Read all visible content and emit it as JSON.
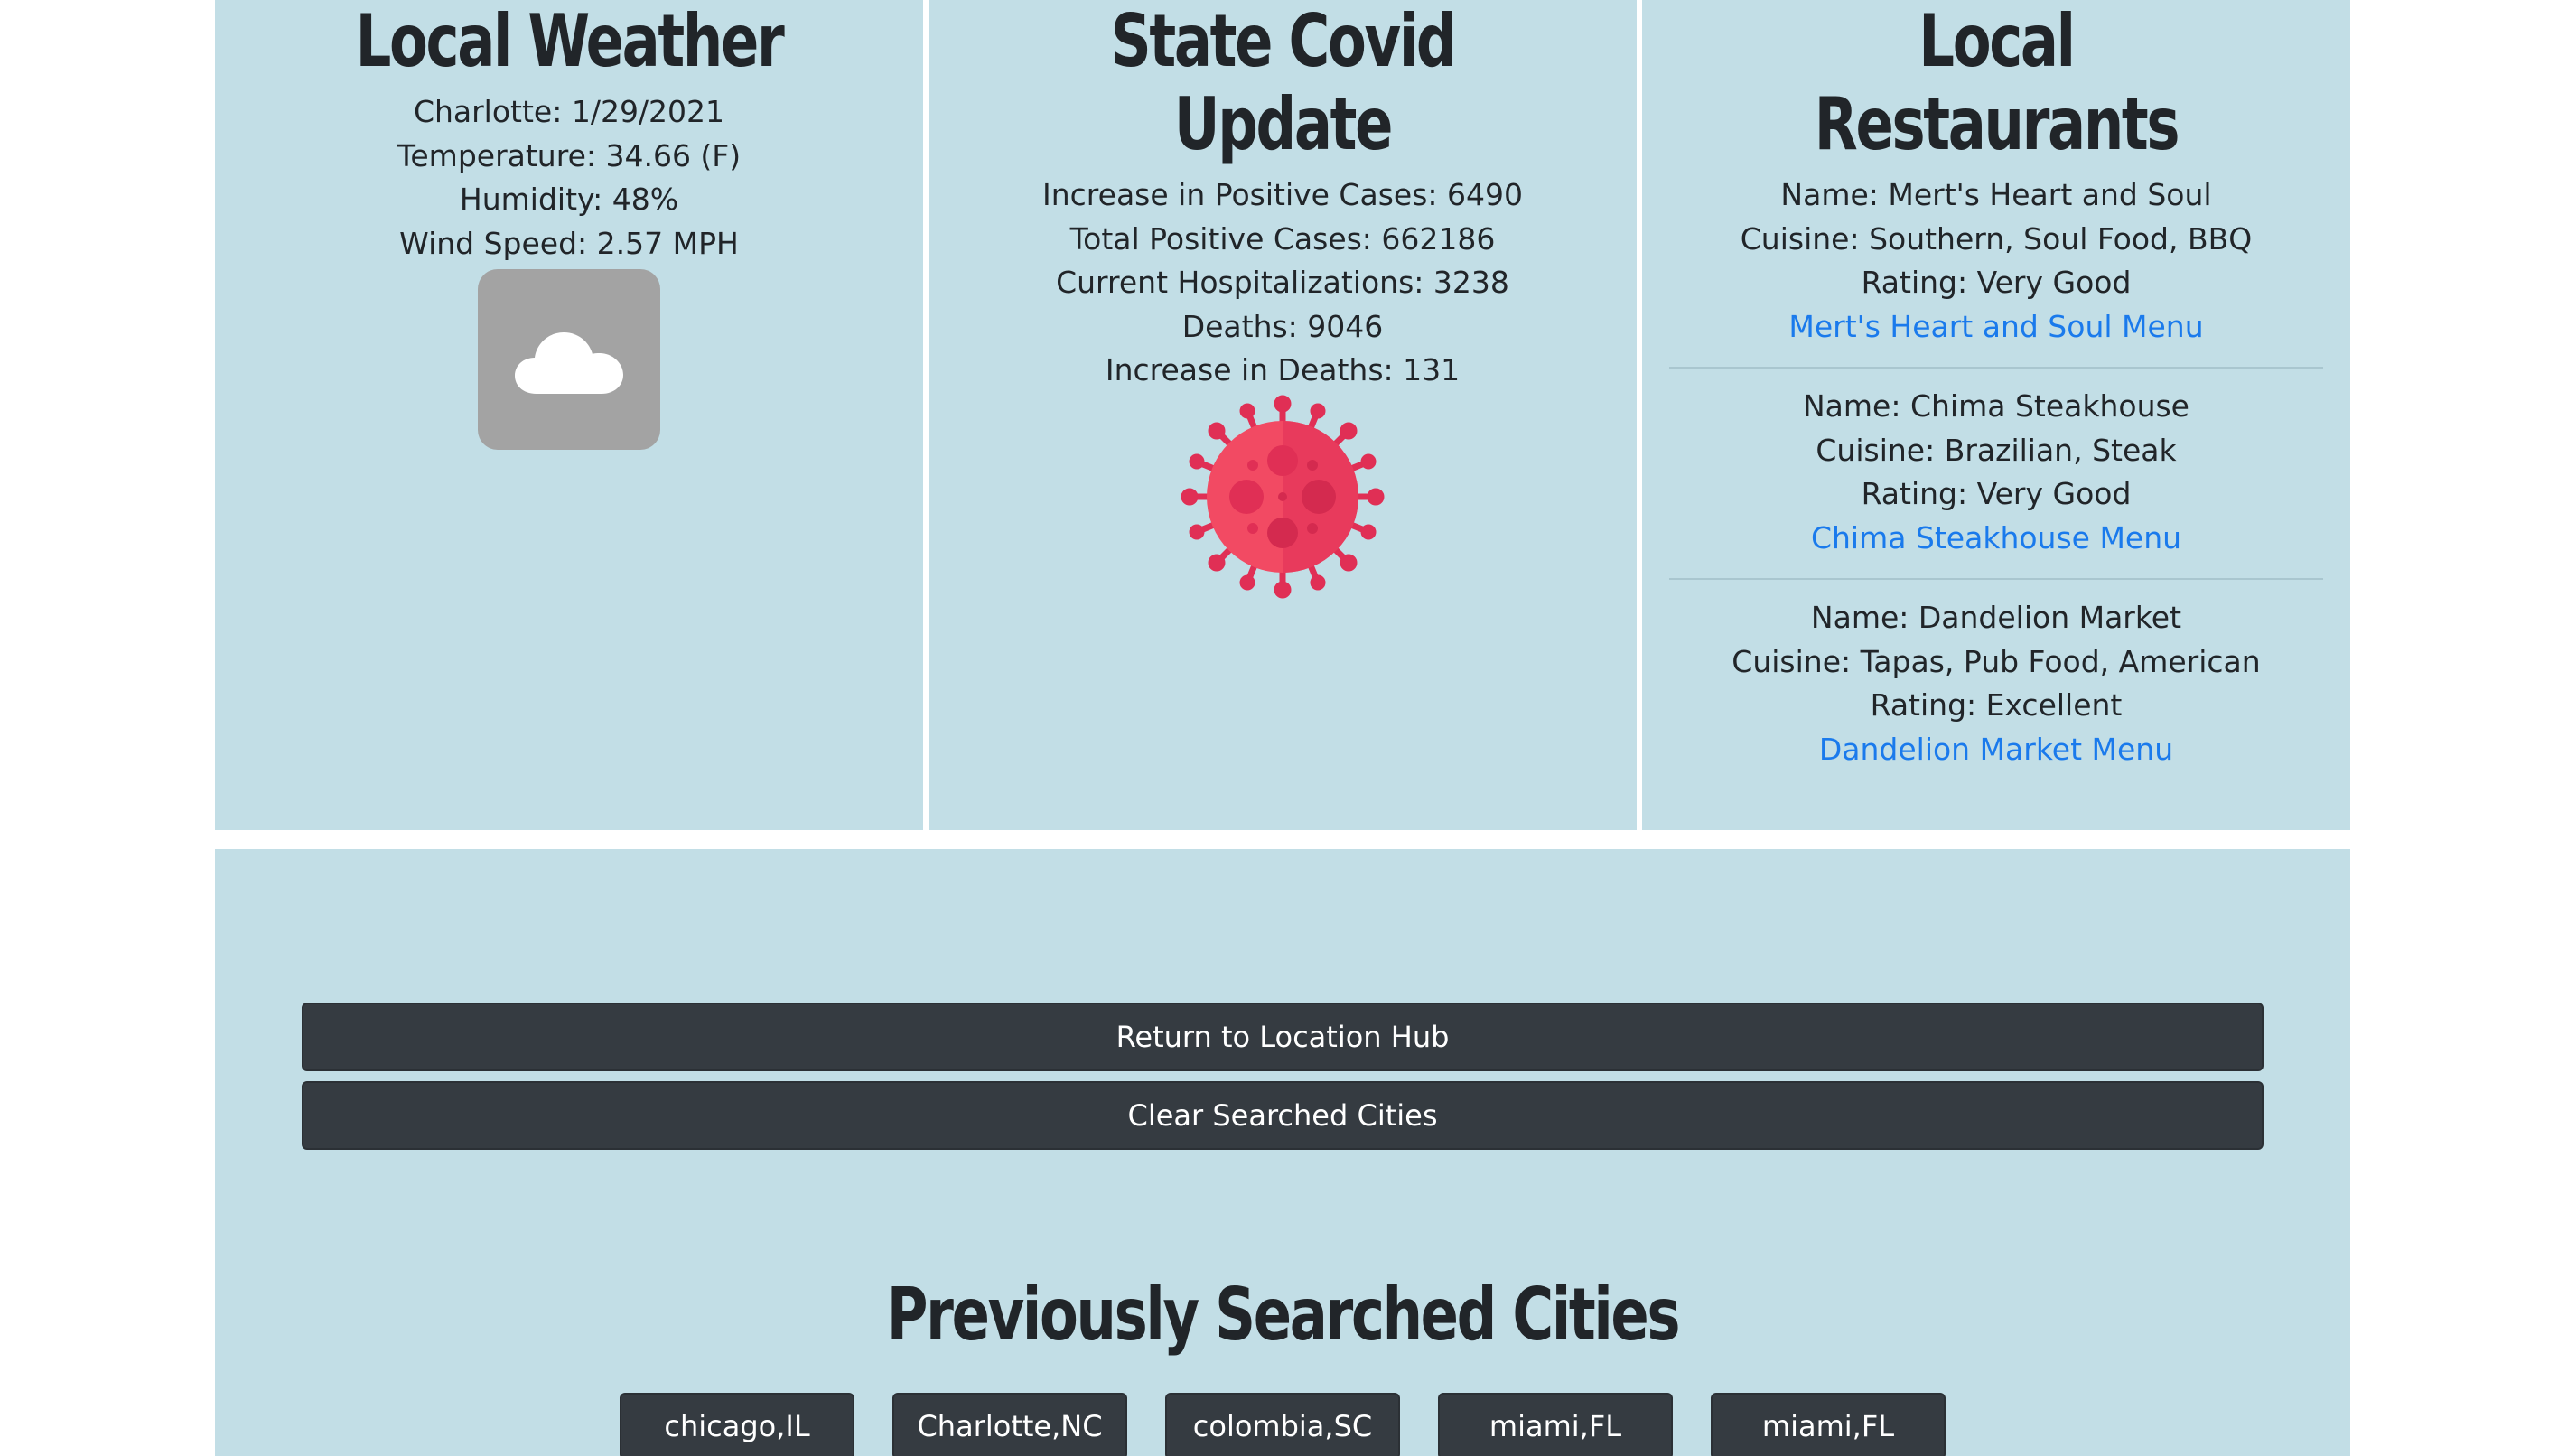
{
  "weather": {
    "title": "Local Weather",
    "date_line": "Charlotte: 1/29/2021",
    "temperature": "Temperature: 34.66 (F)",
    "humidity": "Humidity: 48%",
    "wind": "Wind Speed: 2.57 MPH",
    "icon": "cloud-icon"
  },
  "covid": {
    "title_line1": "State Covid",
    "title_line2": "Update",
    "increase_positive": "Increase in Positive Cases: 6490",
    "total_positive": "Total Positive Cases: 662186",
    "hospitalizations": "Current Hospitalizations: 3238",
    "deaths": "Deaths: 9046",
    "increase_deaths": "Increase in Deaths: 131",
    "icon": "virus-icon"
  },
  "restaurants": {
    "title_line1": "Local",
    "title_line2": "Restaurants",
    "items": [
      {
        "name": "Name: Mert's Heart and Soul",
        "cuisine": "Cuisine: Southern, Soul Food, BBQ",
        "rating": "Rating: Very Good",
        "menu_link": "Mert's Heart and Soul Menu"
      },
      {
        "name": "Name: Chima Steakhouse",
        "cuisine": "Cuisine: Brazilian, Steak",
        "rating": "Rating: Very Good",
        "menu_link": "Chima Steakhouse Menu"
      },
      {
        "name": "Name: Dandelion Market",
        "cuisine": "Cuisine: Tapas, Pub Food, American",
        "rating": "Rating: Excellent",
        "menu_link": "Dandelion Market Menu"
      }
    ]
  },
  "actions": {
    "return_label": "Return to Location Hub",
    "clear_label": "Clear Searched Cities"
  },
  "history": {
    "title": "Previously Searched Cities",
    "cities": [
      "chicago,IL",
      "Charlotte,NC",
      "colombia,SC",
      "miami,FL",
      "miami,FL"
    ]
  },
  "colors": {
    "panel_bg": "#c2dee6",
    "button_bg": "#353b41",
    "link": "#1a7aec",
    "weather_icon_bg": "#a3a3a3",
    "virus_primary": "#f24a63",
    "virus_secondary": "#e02f55"
  }
}
